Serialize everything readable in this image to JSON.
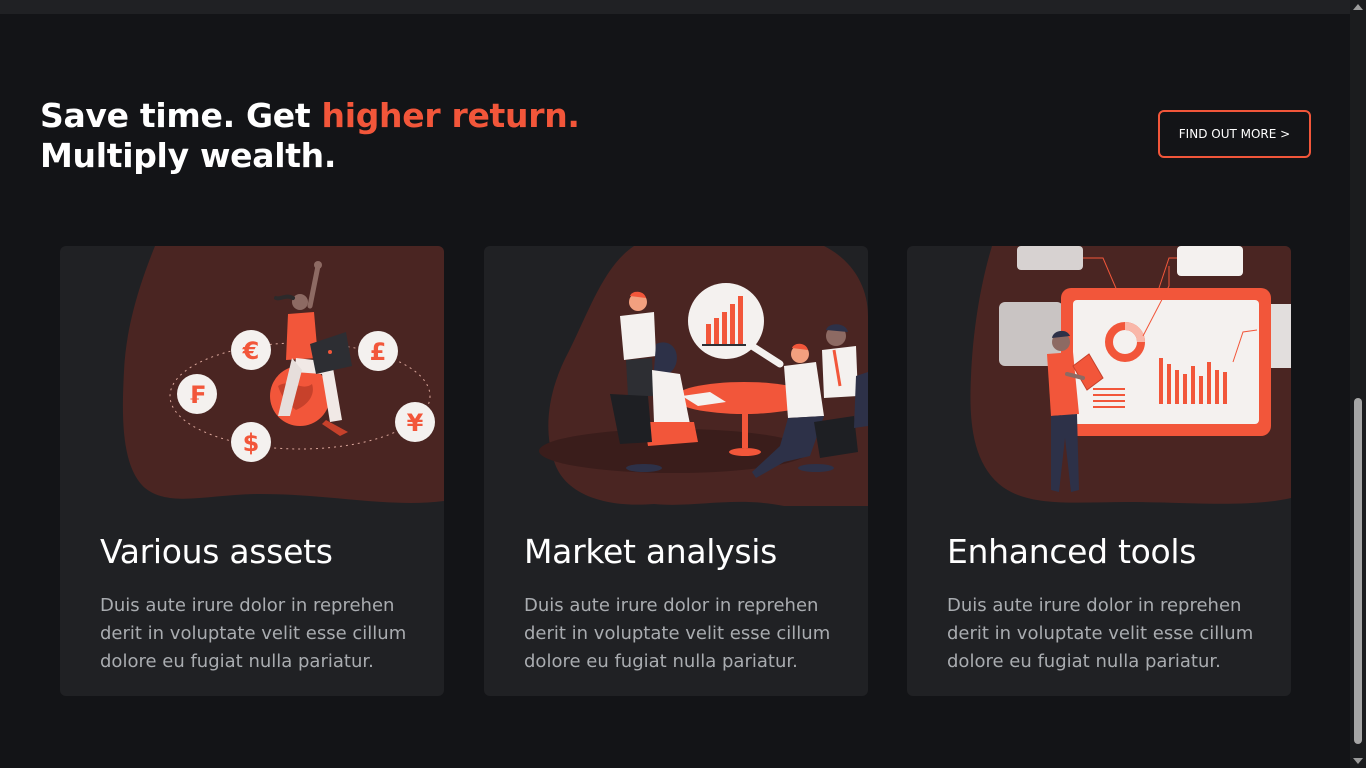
{
  "hero": {
    "headline_part1": "Save time. Get ",
    "headline_accent": "higher return.",
    "headline_line2": "Multiply wealth.",
    "cta_label": "FIND OUT MORE >"
  },
  "cards": [
    {
      "title": "Various assets",
      "description": "Duis aute irure dolor in reprehen derit in voluptate velit esse cillum dolore eu fugiat nulla pariatur.",
      "currency_symbols": [
        "€",
        "£",
        "₣",
        "¥",
        "$"
      ]
    },
    {
      "title": "Market analysis",
      "description": "Duis aute irure dolor in reprehen derit in voluptate velit esse cillum dolore eu fugiat nulla pariatur."
    },
    {
      "title": "Enhanced tools",
      "description": "Duis aute irure dolor in reprehen derit in voluptate velit esse cillum dolore eu fugiat nulla pariatur."
    }
  ],
  "colors": {
    "background": "#131417",
    "card": "#202124",
    "accent": "#f2563a",
    "blob": "#4a2522",
    "body_text": "#a9acb0"
  }
}
